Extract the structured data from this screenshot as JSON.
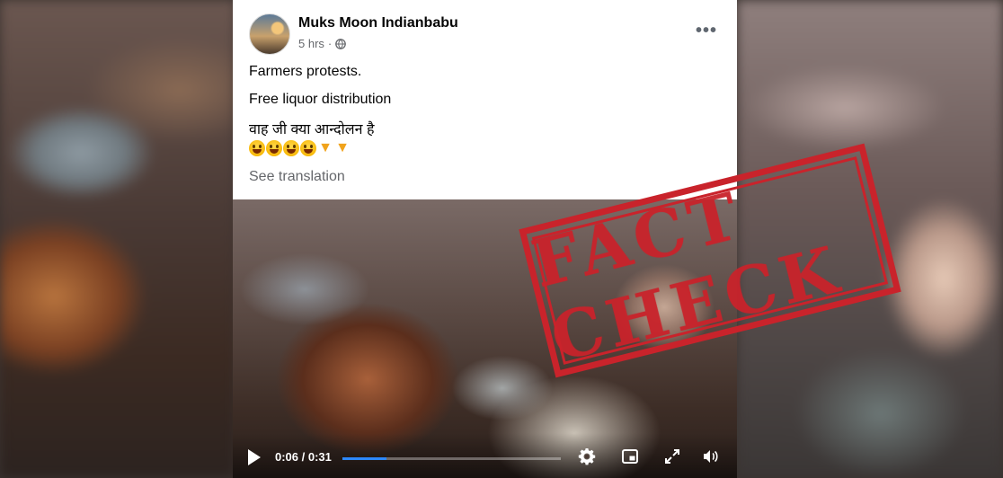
{
  "post": {
    "author": "Muks Moon Indianbabu",
    "time": "5 hrs",
    "separator": "·",
    "more_label": "•••",
    "lines": [
      "Farmers protests.",
      "Free liquor distribution",
      "वाह जी क्या आन्दोलन है"
    ],
    "emojis": [
      "grinning-face",
      "grinning-face",
      "grinning-face",
      "grinning-face",
      "backhand-index-pointing-down",
      "backhand-index-pointing-down"
    ],
    "see_translation": "See translation"
  },
  "video": {
    "time_display": "0:06 / 0:31",
    "progress": 0.2,
    "accent": "#2d88ff"
  },
  "stamp": {
    "text": "FACT CHECK",
    "color": "#c9232b"
  }
}
